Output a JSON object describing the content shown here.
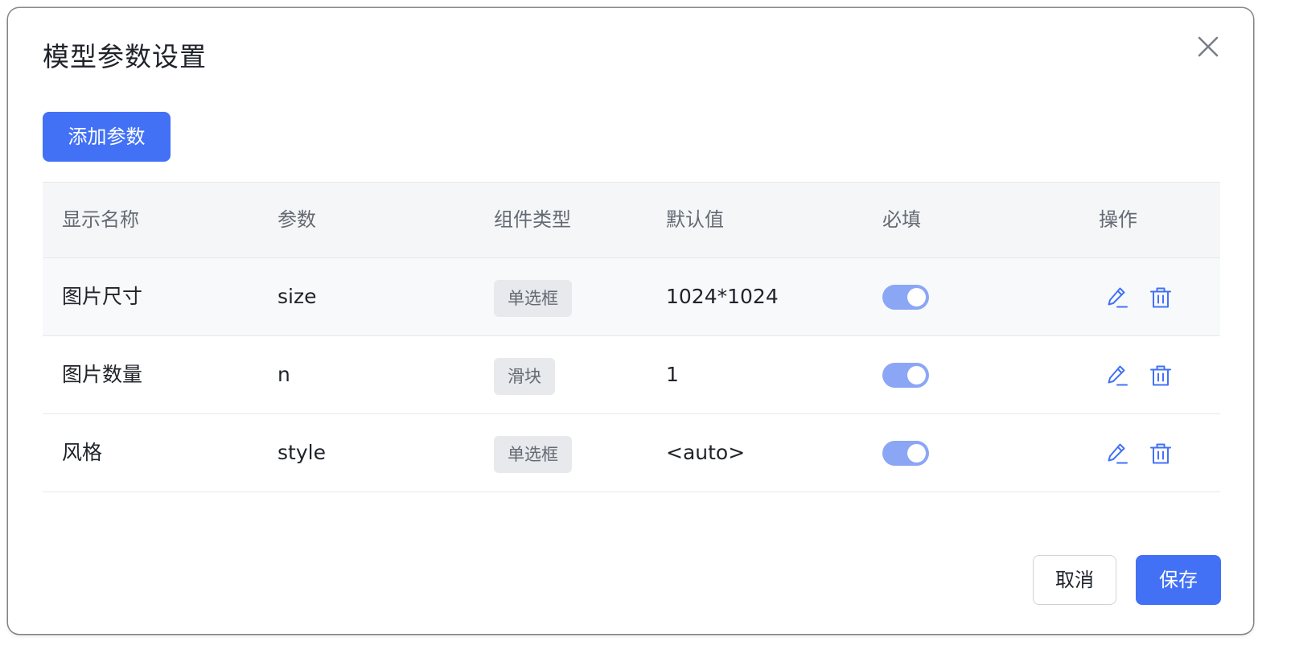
{
  "dialog": {
    "title": "模型参数设置",
    "close_icon": "close-icon"
  },
  "toolbar": {
    "add_label": "添加参数"
  },
  "table": {
    "headers": [
      "显示名称",
      "参数",
      "组件类型",
      "默认值",
      "必填",
      "操作"
    ],
    "rows": [
      {
        "name": "图片尺寸",
        "param": "size",
        "component": "单选框",
        "default": "1024*1024",
        "required": true
      },
      {
        "name": "图片数量",
        "param": "n",
        "component": "滑块",
        "default": "1",
        "required": true
      },
      {
        "name": "风格",
        "param": "style",
        "component": "单选框",
        "default": "<auto>",
        "required": true
      }
    ],
    "action_icons": [
      "edit-icon",
      "delete-icon"
    ]
  },
  "footer": {
    "cancel_label": "取消",
    "save_label": "保存"
  },
  "colors": {
    "primary": "#4271f6",
    "switch_on": "#8ba6f5",
    "header_bg": "#f5f6f8",
    "tag_bg": "#e8e9ec",
    "icon_blue": "#4271f6"
  }
}
